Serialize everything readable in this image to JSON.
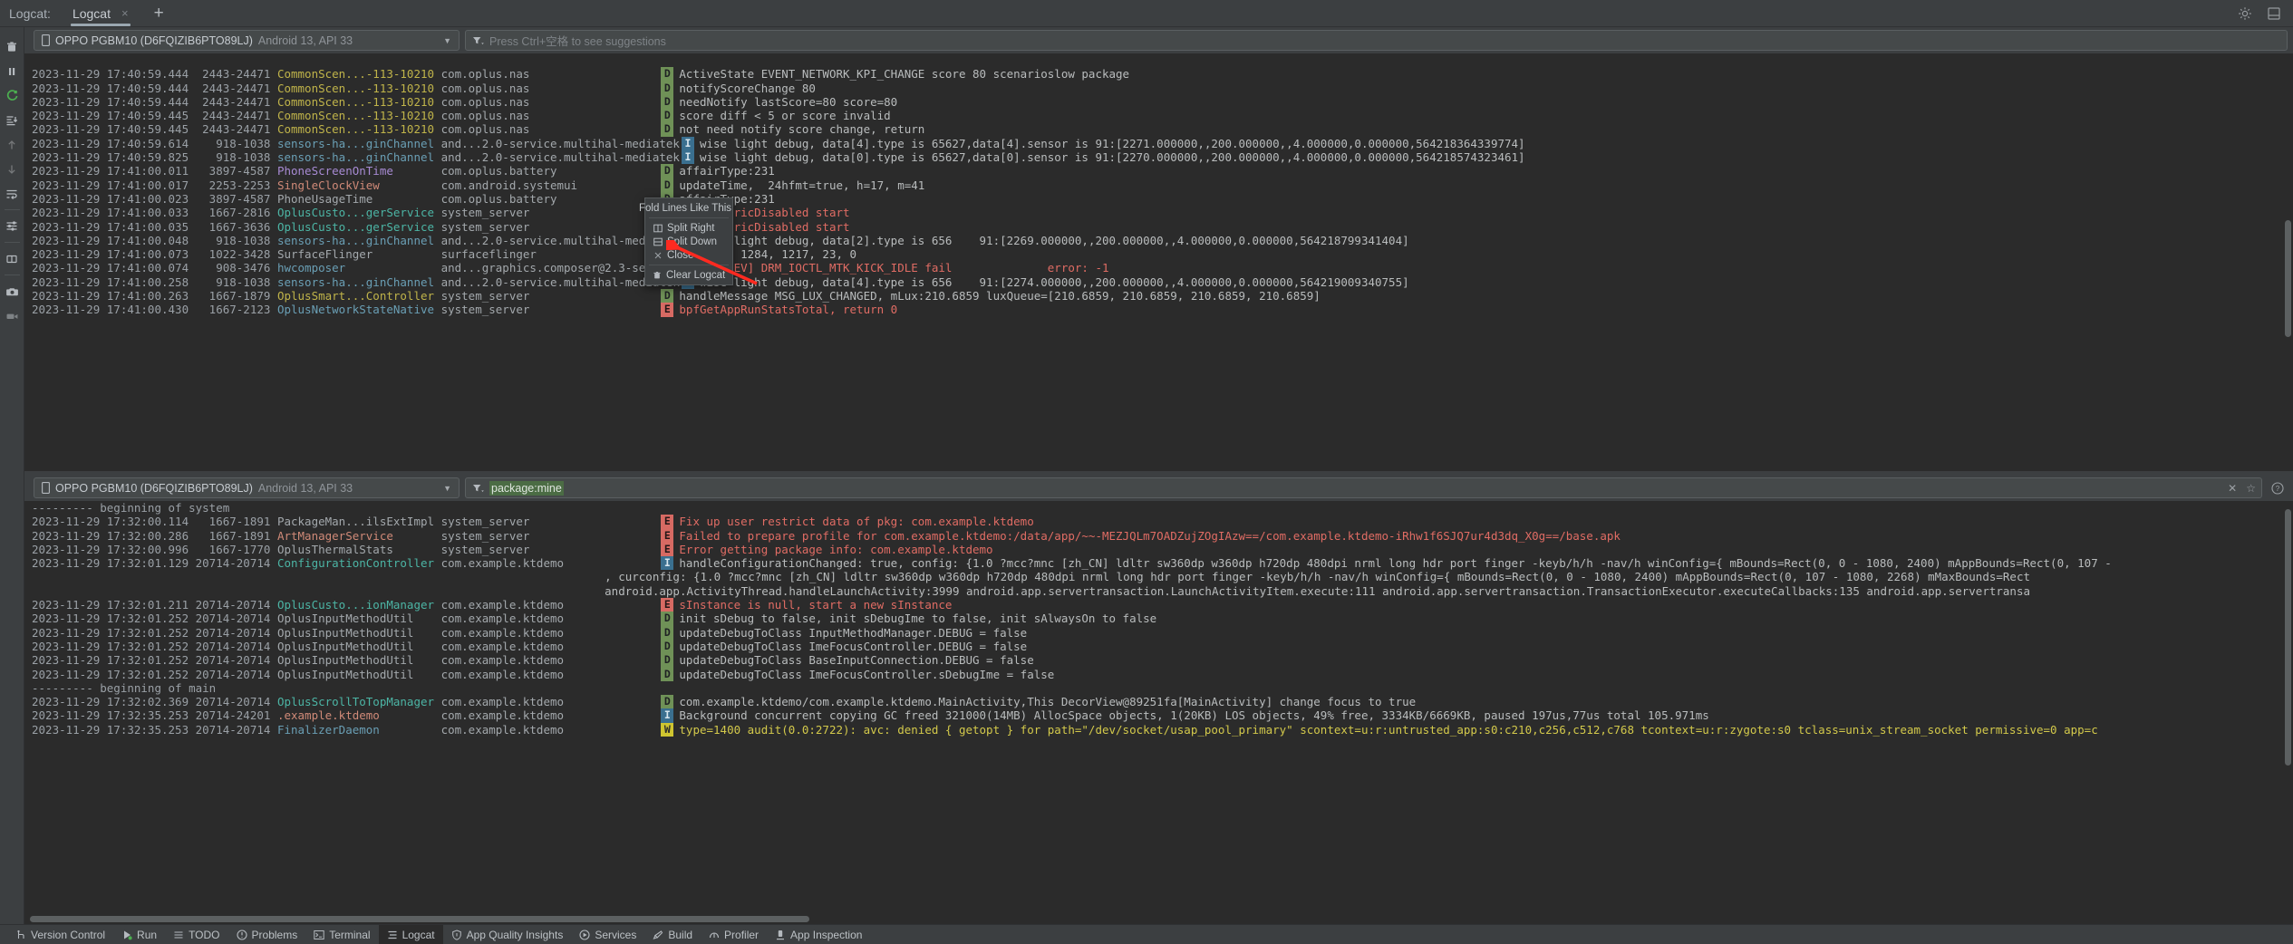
{
  "window": {
    "tool_label": "Logcat:",
    "tab_label": "Logcat",
    "tab_close": "×",
    "new_tab": "+"
  },
  "top_panel": {
    "device": {
      "name": "OPPO PGBM10 (D6FQIZIB6PTO89LJ)",
      "api": "Android 13, API 33"
    },
    "filter": {
      "placeholder": "Press Ctrl+空格 to see suggestions",
      "value": ""
    },
    "rows": [
      {
        "ts": "",
        "pid": "",
        "tag": "",
        "tagcolor": "#9aa0a6",
        "pkg": "",
        "lvl": "",
        "msg": "",
        "partial": true
      },
      {
        "ts": "2023-11-29 17:40:59.444",
        "pid": "2443-24471",
        "tag": "CommonScen...-113-10210",
        "tagcolor": "#c0b44a",
        "pkg": "com.oplus.nas",
        "lvl": "D",
        "msg": "ActiveState EVENT_NETWORK_KPI_CHANGE score 80 scenarioslow package"
      },
      {
        "ts": "2023-11-29 17:40:59.444",
        "pid": "2443-24471",
        "tag": "CommonScen...-113-10210",
        "tagcolor": "#c0b44a",
        "pkg": "com.oplus.nas",
        "lvl": "D",
        "msg": "notifyScoreChange 80"
      },
      {
        "ts": "2023-11-29 17:40:59.444",
        "pid": "2443-24471",
        "tag": "CommonScen...-113-10210",
        "tagcolor": "#c0b44a",
        "pkg": "com.oplus.nas",
        "lvl": "D",
        "msg": "needNotify lastScore=80 score=80"
      },
      {
        "ts": "2023-11-29 17:40:59.445",
        "pid": "2443-24471",
        "tag": "CommonScen...-113-10210",
        "tagcolor": "#c0b44a",
        "pkg": "com.oplus.nas",
        "lvl": "D",
        "msg": "score diff < 5 or score invalid"
      },
      {
        "ts": "2023-11-29 17:40:59.445",
        "pid": "2443-24471",
        "tag": "CommonScen...-113-10210",
        "tagcolor": "#c0b44a",
        "pkg": "com.oplus.nas",
        "lvl": "D",
        "msg": "not need notify score change, return"
      },
      {
        "ts": "2023-11-29 17:40:59.614",
        "pid": "918-1038",
        "tag": "sensors-ha...ginChannel",
        "tagcolor": "#6a9fb5",
        "pkg": "and...2.0-service.multihal-mediatek",
        "lvl": "I",
        "msg": "wise light debug, data[4].type is 65627,data[4].sensor is 91:[2271.000000,,200.000000,,4.000000,0.000000,564218364339774]"
      },
      {
        "ts": "2023-11-29 17:40:59.825",
        "pid": "918-1038",
        "tag": "sensors-ha...ginChannel",
        "tagcolor": "#6a9fb5",
        "pkg": "and...2.0-service.multihal-mediatek",
        "lvl": "I",
        "msg": "wise light debug, data[0].type is 65627,data[0].sensor is 91:[2270.000000,,200.000000,,4.000000,0.000000,564218574323461]"
      },
      {
        "ts": "2023-11-29 17:41:00.011",
        "pid": "3897-4587",
        "tag": "PhoneScreenOnTime",
        "tagcolor": "#a88bd4",
        "pkg": "com.oplus.battery",
        "lvl": "D",
        "msg": "affairType:231"
      },
      {
        "ts": "2023-11-29 17:41:00.017",
        "pid": "2253-2253",
        "tag": "SingleClockView",
        "tagcolor": "#d08a78",
        "pkg": "com.android.systemui",
        "lvl": "D",
        "msg": "updateTime,  24hfmt=true, h=17, m=41"
      },
      {
        "ts": "2023-11-29 17:41:00.023",
        "pid": "3897-4587",
        "tag": "PhoneUsageTime",
        "tagcolor": "#a3a8ac",
        "pkg": "com.oplus.battery",
        "lvl": "D",
        "msg": "affairType:231"
      },
      {
        "ts": "2023-11-29 17:41:00.033",
        "pid": "1667-2816",
        "tag": "OplusCusto...gerService",
        "tagcolor": "#4cb5a5",
        "pkg": "system_server",
        "lvl": "E",
        "msg": "isBiometricDisabled start",
        "msgclass": "e"
      },
      {
        "ts": "2023-11-29 17:41:00.035",
        "pid": "1667-3636",
        "tag": "OplusCusto...gerService",
        "tagcolor": "#4cb5a5",
        "pkg": "system_server",
        "lvl": "E",
        "msg": "isBiometricDisabled start",
        "msgclass": "e"
      },
      {
        "ts": "2023-11-29 17:41:00.048",
        "pid": "918-1038",
        "tag": "sensors-ha...ginChannel",
        "tagcolor": "#6a9fb5",
        "pkg": "and...2.0-service.multihal-mediatek",
        "lvl": "I",
        "msg": "wise light debug, data[2].type is 656    91:[2269.000000,,200.000000,,4.000000,0.000000,564218799341404]"
      },
      {
        "ts": "2023-11-29 17:41:00.073",
        "pid": "1022-3428",
        "tag": "SurfaceFlinger",
        "tagcolor": "#a3a8ac",
        "pkg": "surfaceflinger",
        "lvl": "D",
        "msg": "kickIdle 1284, 1217, 23, 0"
      },
      {
        "ts": "2023-11-29 17:41:00.074",
        "pid": "908-3476",
        "tag": "hwcomposer",
        "tagcolor": "#6a9fb5",
        "pkg": "and...graphics.composer@2.3-service",
        "lvl": "E",
        "msg": "[DRMDEV] DRM_IOCTL_MTK_KICK_IDLE fail              error: -1",
        "msgclass": "e"
      },
      {
        "ts": "2023-11-29 17:41:00.258",
        "pid": "918-1038",
        "tag": "sensors-ha...ginChannel",
        "tagcolor": "#6a9fb5",
        "pkg": "and...2.0-service.multihal-mediatek",
        "lvl": "I",
        "msg": "wise light debug, data[4].type is 656    91:[2274.000000,,200.000000,,4.000000,0.000000,564219009340755]"
      },
      {
        "ts": "2023-11-29 17:41:00.263",
        "pid": "1667-1879",
        "tag": "OplusSmart...Controller",
        "tagcolor": "#c0b44a",
        "pkg": "system_server",
        "lvl": "D",
        "msg": "handleMessage MSG_LUX_CHANGED, mLux:210.6859 luxQueue=[210.6859, 210.6859, 210.6859, 210.6859]"
      },
      {
        "ts": "2023-11-29 17:41:00.430",
        "pid": "1667-2123",
        "tag": "OplusNetworkStateNative",
        "tagcolor": "#6a9fb5",
        "pkg": "system_server",
        "lvl": "E",
        "msg": "bpfGetAppRunStatsTotal, return 0",
        "msgclass": "e",
        "clipped": true
      }
    ]
  },
  "context_menu": {
    "title": "Fold Lines Like This",
    "items": [
      {
        "label": "Split Right",
        "icon": "split-right-icon"
      },
      {
        "label": "Split Down",
        "icon": "split-down-icon"
      },
      {
        "label": "Close",
        "icon": "close-icon"
      },
      {
        "label": "Clear Logcat",
        "icon": "trash-icon"
      }
    ]
  },
  "bottom_panel": {
    "device": {
      "name": "OPPO PGBM10 (D6FQIZIB6PTO89LJ)",
      "api": "Android 13, API 33"
    },
    "filter": {
      "value": "package:mine",
      "placeholder": ""
    },
    "rows": [
      {
        "sep": "--------- beginning of system"
      },
      {
        "ts": "2023-11-29 17:32:00.114",
        "pid": "1667-1891",
        "tag": "PackageMan...ilsExtImpl",
        "tagcolor": "#a3a8ac",
        "pkg": "system_server",
        "lvl": "E",
        "msg": "Fix up user restrict data of pkg: com.example.ktdemo",
        "msgclass": "e"
      },
      {
        "ts": "2023-11-29 17:32:00.286",
        "pid": "1667-1891",
        "tag": "ArtManagerService",
        "tagcolor": "#d08a78",
        "pkg": "system_server",
        "lvl": "E",
        "msg": "Failed to prepare profile for com.example.ktdemo:/data/app/~~-MEZJQLm7OADZujZOgIAzw==/com.example.ktdemo-iRhw1f6SJQ7ur4d3dq_X0g==/base.apk",
        "msgclass": "e"
      },
      {
        "ts": "2023-11-29 17:32:00.996",
        "pid": "1667-1770",
        "tag": "OplusThermalStats",
        "tagcolor": "#a3a8ac",
        "pkg": "system_server",
        "lvl": "E",
        "msg": "Error getting package info: com.example.ktdemo",
        "msgclass": "e"
      },
      {
        "ts": "2023-11-29 17:32:01.129",
        "pid": "20714-20714",
        "tag": "ConfigurationController",
        "tagcolor": "#4cb5a5",
        "pkg": "com.example.ktdemo",
        "lvl": "I",
        "msg": "handleConfigurationChanged: true, config: {1.0 ?mcc?mnc [zh_CN] ldltr sw360dp w360dp h720dp 480dpi nrml long hdr port finger -keyb/h/h -nav/h winConfig={ mBounds=Rect(0, 0 - 1080, 2400) mAppBounds=Rect(0, 107 -"
      },
      {
        "cont": true,
        "msg": ", curconfig: {1.0 ?mcc?mnc [zh_CN] ldltr sw360dp w360dp h720dp 480dpi nrml long hdr port finger -keyb/h/h -nav/h winConfig={ mBounds=Rect(0, 0 - 1080, 2400) mAppBounds=Rect(0, 107 - 1080, 2268) mMaxBounds=Rect"
      },
      {
        "cont": true,
        "msg": "android.app.ActivityThread.handleLaunchActivity:3999 android.app.servertransaction.LaunchActivityItem.execute:111 android.app.servertransaction.TransactionExecutor.executeCallbacks:135 android.app.servertransa"
      },
      {
        "ts": "2023-11-29 17:32:01.211",
        "pid": "20714-20714",
        "tag": "OplusCusto...ionManager",
        "tagcolor": "#4cb5a5",
        "pkg": "com.example.ktdemo",
        "lvl": "E",
        "msg": "sInstance is null, start a new sInstance",
        "msgclass": "e"
      },
      {
        "ts": "2023-11-29 17:32:01.252",
        "pid": "20714-20714",
        "tag": "OplusInputMethodUtil",
        "tagcolor": "#a3a8ac",
        "pkg": "com.example.ktdemo",
        "lvl": "D",
        "msg": "init sDebug to false, init sDebugIme to false, init sAlwaysOn to false"
      },
      {
        "ts": "2023-11-29 17:32:01.252",
        "pid": "20714-20714",
        "tag": "OplusInputMethodUtil",
        "tagcolor": "#a3a8ac",
        "pkg": "com.example.ktdemo",
        "lvl": "D",
        "msg": "updateDebugToClass InputMethodManager.DEBUG = false"
      },
      {
        "ts": "2023-11-29 17:32:01.252",
        "pid": "20714-20714",
        "tag": "OplusInputMethodUtil",
        "tagcolor": "#a3a8ac",
        "pkg": "com.example.ktdemo",
        "lvl": "D",
        "msg": "updateDebugToClass ImeFocusController.DEBUG = false"
      },
      {
        "ts": "2023-11-29 17:32:01.252",
        "pid": "20714-20714",
        "tag": "OplusInputMethodUtil",
        "tagcolor": "#a3a8ac",
        "pkg": "com.example.ktdemo",
        "lvl": "D",
        "msg": "updateDebugToClass BaseInputConnection.DEBUG = false"
      },
      {
        "ts": "2023-11-29 17:32:01.252",
        "pid": "20714-20714",
        "tag": "OplusInputMethodUtil",
        "tagcolor": "#a3a8ac",
        "pkg": "com.example.ktdemo",
        "lvl": "D",
        "msg": "updateDebugToClass ImeFocusController.sDebugIme = false"
      },
      {
        "sep": "--------- beginning of main"
      },
      {
        "ts": "2023-11-29 17:32:02.369",
        "pid": "20714-20714",
        "tag": "OplusScrollToTopManager",
        "tagcolor": "#4cb5a5",
        "pkg": "com.example.ktdemo",
        "lvl": "D",
        "msg": "com.example.ktdemo/com.example.ktdemo.MainActivity,This DecorView@89251fa[MainActivity] change focus to true"
      },
      {
        "ts": "2023-11-29 17:32:35.253",
        "pid": "20714-24201",
        "tag": ".example.ktdemo",
        "tagcolor": "#d08a78",
        "pkg": "com.example.ktdemo",
        "lvl": "I",
        "msg": "Background concurrent copying GC freed 321000(14MB) AllocSpace objects, 1(20KB) LOS objects, 49% free, 3334KB/6669KB, paused 197us,77us total 105.971ms"
      },
      {
        "ts": "2023-11-29 17:32:35.253",
        "pid": "20714-20714",
        "tag": "FinalizerDaemon",
        "tagcolor": "#6a9fb5",
        "pkg": "com.example.ktdemo",
        "lvl": "W",
        "msg": "type=1400 audit(0.0:2722): avc: denied { getopt } for path=\"/dev/socket/usap_pool_primary\" scontext=u:r:untrusted_app:s0:c210,c256,c512,c768 tcontext=u:r:zygote:s0 tclass=unix_stream_socket permissive=0 app=c",
        "msgclass": "w"
      }
    ]
  },
  "statusbar": {
    "items": [
      {
        "label": "Version Control",
        "icon": "branch-icon",
        "active": false
      },
      {
        "label": "Run",
        "icon": "run-icon",
        "active": false
      },
      {
        "label": "TODO",
        "icon": "todo-icon",
        "active": false
      },
      {
        "label": "Problems",
        "icon": "problems-icon",
        "active": false
      },
      {
        "label": "Terminal",
        "icon": "terminal-icon",
        "active": false
      },
      {
        "label": "Logcat",
        "icon": "logcat-icon",
        "active": true
      },
      {
        "label": "App Quality Insights",
        "icon": "shield-icon",
        "active": false
      },
      {
        "label": "Services",
        "icon": "services-icon",
        "active": false
      },
      {
        "label": "Build",
        "icon": "build-icon",
        "active": false
      },
      {
        "label": "Profiler",
        "icon": "profiler-icon",
        "active": false
      },
      {
        "label": "App Inspection",
        "icon": "inspection-icon",
        "active": false
      }
    ]
  },
  "rail_icons": [
    "trash-icon",
    "pause-icon",
    "restart-icon",
    "scroll-to-end-icon",
    "up-arrow-icon",
    "down-arrow-icon",
    "soft-wrap-icon",
    "filter-settings-icon",
    "split-panel-icon",
    "screenshot-icon",
    "record-video-icon"
  ],
  "colors": {
    "accent_green": "#6f9157",
    "accent_red": "#d76a63",
    "accent_blue": "#3a6f8f",
    "accent_yellow": "#cfc530",
    "bg_editor": "#2b2b2b",
    "bg_chrome": "#3c3f41",
    "arrow_red": "#ff2a20"
  }
}
